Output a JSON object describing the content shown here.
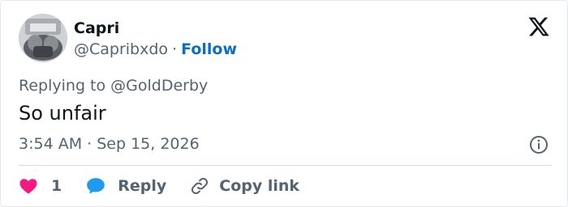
{
  "author": {
    "display_name": "Capri",
    "handle": "@Capribxdo",
    "separator": "·",
    "follow_label": "Follow"
  },
  "tweet": {
    "replying_to": "Replying to @GoldDerby",
    "text": "So unfair",
    "timestamp": "3:54 AM · Sep 15, 2026"
  },
  "actions": {
    "like_count": "1",
    "reply_label": "Reply",
    "copy_link_label": "Copy link"
  },
  "icons": {
    "logo": "x-logo-icon",
    "info": "info-icon",
    "like": "heart-icon",
    "reply": "chat-bubble-icon",
    "copy": "link-icon"
  },
  "colors": {
    "follow": "#0a6fc2",
    "heart": "#f91880",
    "reply_bubble": "#1d9bf0",
    "secondary_text": "#536471",
    "primary_text": "#0f1419"
  }
}
